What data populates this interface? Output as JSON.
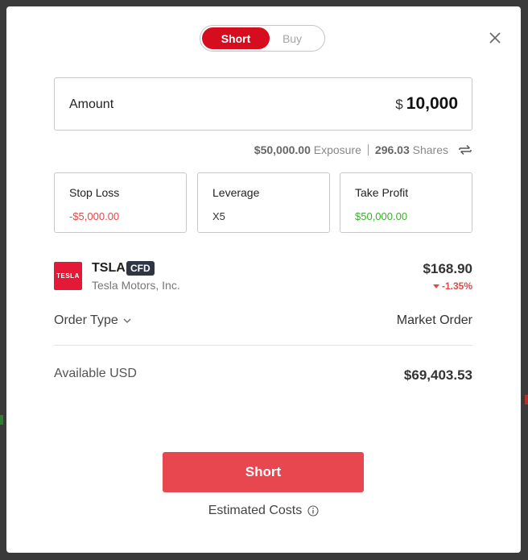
{
  "toggle": {
    "short_label": "Short",
    "buy_label": "Buy"
  },
  "amount": {
    "label": "Amount",
    "currency": "$",
    "value": "10,000"
  },
  "exposure": {
    "exposure_value": "$50,000.00",
    "exposure_label": "Exposure",
    "shares_value": "296.03",
    "shares_label": "Shares"
  },
  "cards": {
    "stop_loss": {
      "label": "Stop Loss",
      "value": "-$5,000.00"
    },
    "leverage": {
      "label": "Leverage",
      "value": "X5"
    },
    "take_profit": {
      "label": "Take Profit",
      "value": "$50,000.00"
    }
  },
  "instrument": {
    "logo_text": "TESLA",
    "ticker": "TSLA",
    "badge": "CFD",
    "company": "Tesla Motors, Inc.",
    "price": "$168.90",
    "change": "-1.35%"
  },
  "order": {
    "label": "Order Type",
    "value": "Market Order"
  },
  "available": {
    "label": "Available USD",
    "value": "$69,403.53"
  },
  "action": {
    "button_label": "Short",
    "estimated_costs_label": "Estimated Costs"
  },
  "icons": {
    "close": "close-icon",
    "swap": "swap-icon",
    "chevron": "chevron-down-icon",
    "info": "info-icon"
  },
  "colors": {
    "toggle_active": "#d50d1f",
    "button": "#e8474f",
    "negative": "#e04848",
    "positive": "#3aae2d",
    "tesla_red": "#e31937",
    "badge": "#2f3542"
  }
}
